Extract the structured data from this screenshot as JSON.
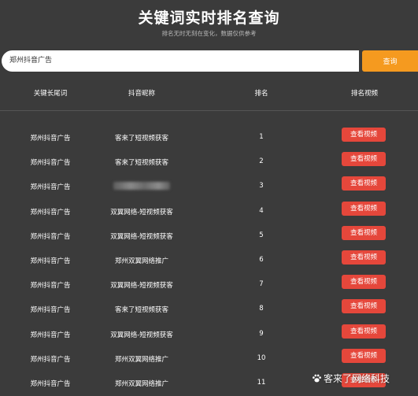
{
  "header": {
    "title": "关键词实时排名查询",
    "subtitle": "排名无时无刻在变化，数据仅供参考"
  },
  "search": {
    "value": "郑州抖音广告",
    "button_label": "查询"
  },
  "table": {
    "columns": [
      "关键长尾词",
      "抖音昵称",
      "排名",
      "排名视频"
    ],
    "rows": [
      {
        "keyword": "郑州抖音广告",
        "nickname": "客来了短视频获客",
        "rank": "1",
        "action": "查看视频"
      },
      {
        "keyword": "郑州抖音广告",
        "nickname": "客来了短视频获客",
        "rank": "2",
        "action": "查看视频"
      },
      {
        "keyword": "郑州抖音广告",
        "nickname": "",
        "rank": "3",
        "action": "查看视频"
      },
      {
        "keyword": "郑州抖音广告",
        "nickname": "双翼网络-短视频获客",
        "rank": "4",
        "action": "查看视频"
      },
      {
        "keyword": "郑州抖音广告",
        "nickname": "双翼网络-短视频获客",
        "rank": "5",
        "action": "查看视频"
      },
      {
        "keyword": "郑州抖音广告",
        "nickname": "郑州双翼网络推广",
        "rank": "6",
        "action": "查看视频"
      },
      {
        "keyword": "郑州抖音广告",
        "nickname": "双翼网络-短视频获客",
        "rank": "7",
        "action": "查看视频"
      },
      {
        "keyword": "郑州抖音广告",
        "nickname": "客来了短视频获客",
        "rank": "8",
        "action": "查看视频"
      },
      {
        "keyword": "郑州抖音广告",
        "nickname": "双翼网络-短视频获客",
        "rank": "9",
        "action": "查看视频"
      },
      {
        "keyword": "郑州抖音广告",
        "nickname": "郑州双翼网络推广",
        "rank": "10",
        "action": "查看视频"
      },
      {
        "keyword": "郑州抖音广告",
        "nickname": "郑州双翼网络推广",
        "rank": "11",
        "action": "查看视频"
      }
    ]
  },
  "watermark": {
    "text": "客来了网络科技",
    "icon": "paw-icon"
  },
  "colors": {
    "background": "#3b3b3b",
    "accent": "#f59a1f",
    "button": "#e5473b"
  }
}
